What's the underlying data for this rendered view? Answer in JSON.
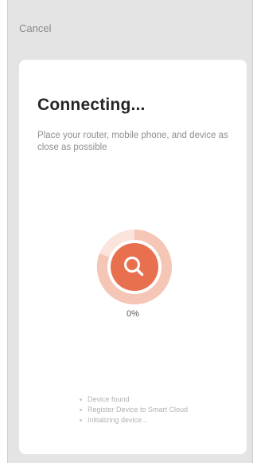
{
  "header": {
    "cancel_label": "Cancel"
  },
  "main": {
    "title": "Connecting...",
    "subtitle": "Place your router, mobile phone, and device as close as possible",
    "progress_label": "0%",
    "progress_value": 0,
    "steps": [
      {
        "label": "Device found"
      },
      {
        "label": "Register Device to Smart Cloud"
      },
      {
        "label": "Initializing device..."
      }
    ]
  },
  "colors": {
    "accent": "#e8704f",
    "accent_light": "#f5c6b6",
    "accent_faint": "#fbe4dc"
  }
}
